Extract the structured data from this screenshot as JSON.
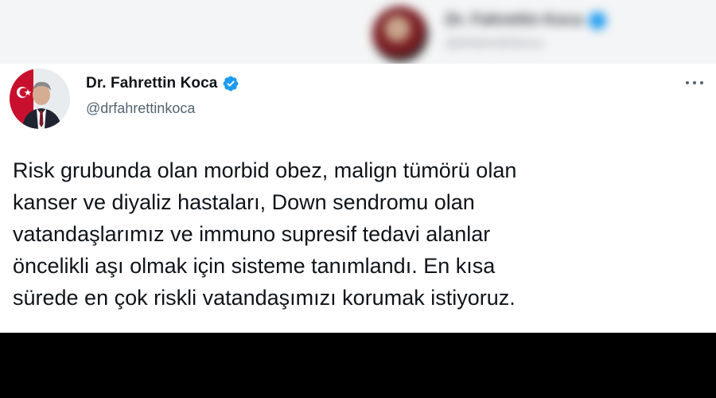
{
  "background": {
    "blurred_name": "Dr. Fahrettin Koca",
    "blurred_handle": "@drfahrettinkoca"
  },
  "tweet": {
    "author": {
      "display_name": "Dr. Fahrettin Koca",
      "handle": "@drfahrettinkoca",
      "verified": true,
      "avatar_icon": "profile-photo"
    },
    "more_icon": "ellipsis-icon",
    "text_lines": [
      "Risk grubunda olan morbid obez, malign tümörü olan",
      "kanser ve diyaliz hastaları, Down sendromu olan",
      "vatandaşlarımız ve immuno supresif tedavi alanlar",
      "öncelikli aşı olmak için sisteme tanımlandı. En kısa",
      "sürede en çok riskli vatandaşımızı korumak istiyoruz."
    ]
  },
  "colors": {
    "verified": "#1d9bf0",
    "text": "#0f1419",
    "secondary_text": "#536471",
    "bottom_bar": "#000000"
  }
}
